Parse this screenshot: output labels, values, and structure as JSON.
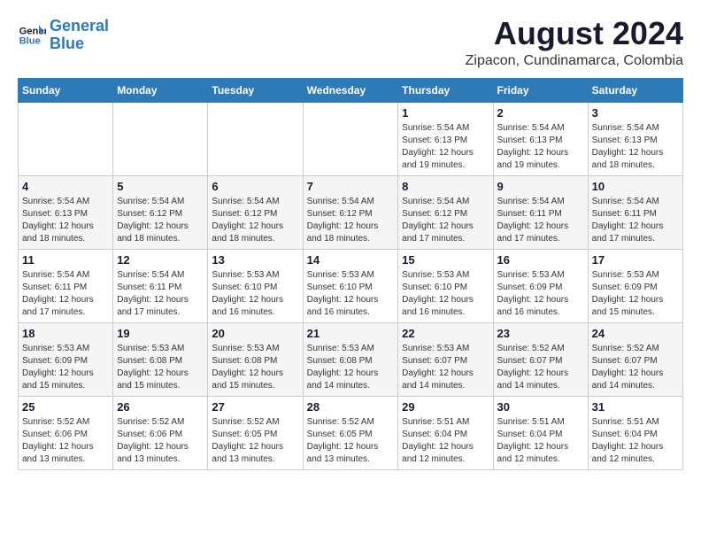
{
  "header": {
    "logo_line1": "General",
    "logo_line2": "Blue",
    "month_year": "August 2024",
    "location": "Zipacon, Cundinamarca, Colombia"
  },
  "days_of_week": [
    "Sunday",
    "Monday",
    "Tuesday",
    "Wednesday",
    "Thursday",
    "Friday",
    "Saturday"
  ],
  "weeks": [
    [
      {
        "day": "",
        "info": ""
      },
      {
        "day": "",
        "info": ""
      },
      {
        "day": "",
        "info": ""
      },
      {
        "day": "",
        "info": ""
      },
      {
        "day": "1",
        "info": "Sunrise: 5:54 AM\nSunset: 6:13 PM\nDaylight: 12 hours\nand 19 minutes."
      },
      {
        "day": "2",
        "info": "Sunrise: 5:54 AM\nSunset: 6:13 PM\nDaylight: 12 hours\nand 19 minutes."
      },
      {
        "day": "3",
        "info": "Sunrise: 5:54 AM\nSunset: 6:13 PM\nDaylight: 12 hours\nand 18 minutes."
      }
    ],
    [
      {
        "day": "4",
        "info": "Sunrise: 5:54 AM\nSunset: 6:13 PM\nDaylight: 12 hours\nand 18 minutes."
      },
      {
        "day": "5",
        "info": "Sunrise: 5:54 AM\nSunset: 6:12 PM\nDaylight: 12 hours\nand 18 minutes."
      },
      {
        "day": "6",
        "info": "Sunrise: 5:54 AM\nSunset: 6:12 PM\nDaylight: 12 hours\nand 18 minutes."
      },
      {
        "day": "7",
        "info": "Sunrise: 5:54 AM\nSunset: 6:12 PM\nDaylight: 12 hours\nand 18 minutes."
      },
      {
        "day": "8",
        "info": "Sunrise: 5:54 AM\nSunset: 6:12 PM\nDaylight: 12 hours\nand 17 minutes."
      },
      {
        "day": "9",
        "info": "Sunrise: 5:54 AM\nSunset: 6:11 PM\nDaylight: 12 hours\nand 17 minutes."
      },
      {
        "day": "10",
        "info": "Sunrise: 5:54 AM\nSunset: 6:11 PM\nDaylight: 12 hours\nand 17 minutes."
      }
    ],
    [
      {
        "day": "11",
        "info": "Sunrise: 5:54 AM\nSunset: 6:11 PM\nDaylight: 12 hours\nand 17 minutes."
      },
      {
        "day": "12",
        "info": "Sunrise: 5:54 AM\nSunset: 6:11 PM\nDaylight: 12 hours\nand 17 minutes."
      },
      {
        "day": "13",
        "info": "Sunrise: 5:53 AM\nSunset: 6:10 PM\nDaylight: 12 hours\nand 16 minutes."
      },
      {
        "day": "14",
        "info": "Sunrise: 5:53 AM\nSunset: 6:10 PM\nDaylight: 12 hours\nand 16 minutes."
      },
      {
        "day": "15",
        "info": "Sunrise: 5:53 AM\nSunset: 6:10 PM\nDaylight: 12 hours\nand 16 minutes."
      },
      {
        "day": "16",
        "info": "Sunrise: 5:53 AM\nSunset: 6:09 PM\nDaylight: 12 hours\nand 16 minutes."
      },
      {
        "day": "17",
        "info": "Sunrise: 5:53 AM\nSunset: 6:09 PM\nDaylight: 12 hours\nand 15 minutes."
      }
    ],
    [
      {
        "day": "18",
        "info": "Sunrise: 5:53 AM\nSunset: 6:09 PM\nDaylight: 12 hours\nand 15 minutes."
      },
      {
        "day": "19",
        "info": "Sunrise: 5:53 AM\nSunset: 6:08 PM\nDaylight: 12 hours\nand 15 minutes."
      },
      {
        "day": "20",
        "info": "Sunrise: 5:53 AM\nSunset: 6:08 PM\nDaylight: 12 hours\nand 15 minutes."
      },
      {
        "day": "21",
        "info": "Sunrise: 5:53 AM\nSunset: 6:08 PM\nDaylight: 12 hours\nand 14 minutes."
      },
      {
        "day": "22",
        "info": "Sunrise: 5:53 AM\nSunset: 6:07 PM\nDaylight: 12 hours\nand 14 minutes."
      },
      {
        "day": "23",
        "info": "Sunrise: 5:52 AM\nSunset: 6:07 PM\nDaylight: 12 hours\nand 14 minutes."
      },
      {
        "day": "24",
        "info": "Sunrise: 5:52 AM\nSunset: 6:07 PM\nDaylight: 12 hours\nand 14 minutes."
      }
    ],
    [
      {
        "day": "25",
        "info": "Sunrise: 5:52 AM\nSunset: 6:06 PM\nDaylight: 12 hours\nand 13 minutes."
      },
      {
        "day": "26",
        "info": "Sunrise: 5:52 AM\nSunset: 6:06 PM\nDaylight: 12 hours\nand 13 minutes."
      },
      {
        "day": "27",
        "info": "Sunrise: 5:52 AM\nSunset: 6:05 PM\nDaylight: 12 hours\nand 13 minutes."
      },
      {
        "day": "28",
        "info": "Sunrise: 5:52 AM\nSunset: 6:05 PM\nDaylight: 12 hours\nand 13 minutes."
      },
      {
        "day": "29",
        "info": "Sunrise: 5:51 AM\nSunset: 6:04 PM\nDaylight: 12 hours\nand 12 minutes."
      },
      {
        "day": "30",
        "info": "Sunrise: 5:51 AM\nSunset: 6:04 PM\nDaylight: 12 hours\nand 12 minutes."
      },
      {
        "day": "31",
        "info": "Sunrise: 5:51 AM\nSunset: 6:04 PM\nDaylight: 12 hours\nand 12 minutes."
      }
    ]
  ]
}
